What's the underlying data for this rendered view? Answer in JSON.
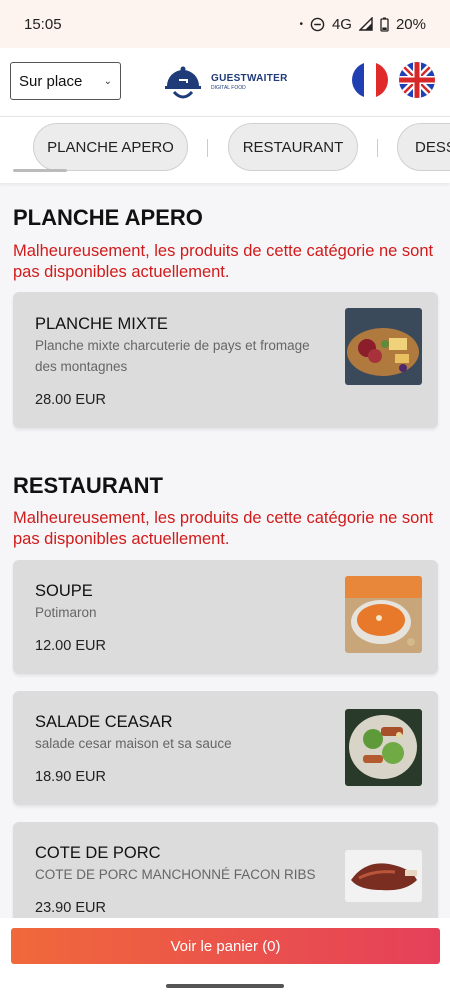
{
  "status": {
    "time": "15:05",
    "dot": "•",
    "network": "4G",
    "battery": "20%"
  },
  "header": {
    "service_mode": "Sur place",
    "logo_title": "GUESTWAITER",
    "logo_subtitle": "DIGITAL FOOD",
    "colors": {
      "brand": "#1f3b78"
    }
  },
  "tabs": [
    "PLANCHE APERO",
    "RESTAURANT",
    "DESSERTS"
  ],
  "sections": [
    {
      "title": "PLANCHE APERO",
      "message": "Malheureusement, les produits de cette catégorie ne sont pas disponibles actuellement.",
      "items": [
        {
          "name": "PLANCHE MIXTE",
          "description": "Planche mixte charcuterie de pays et fromage des montagnes",
          "price": "28.00 EUR"
        }
      ]
    },
    {
      "title": "RESTAURANT",
      "message": "Malheureusement, les produits de cette catégorie ne sont pas disponibles actuellement.",
      "items": [
        {
          "name": "SOUPE",
          "description": "Potimaron",
          "price": "12.00 EUR"
        },
        {
          "name": "SALADE CEASAR",
          "description": "salade cesar maison et sa sauce",
          "price": "18.90 EUR"
        },
        {
          "name": "COTE DE PORC",
          "description": "COTE DE PORC MANCHONNÉ FACON RIBS",
          "price": "23.90 EUR"
        }
      ]
    }
  ],
  "cart_button": "Voir le panier (0)",
  "colors": {
    "unavailable": "#d21a1a",
    "cart_start": "#f0693a",
    "cart_end": "#e5405a"
  }
}
